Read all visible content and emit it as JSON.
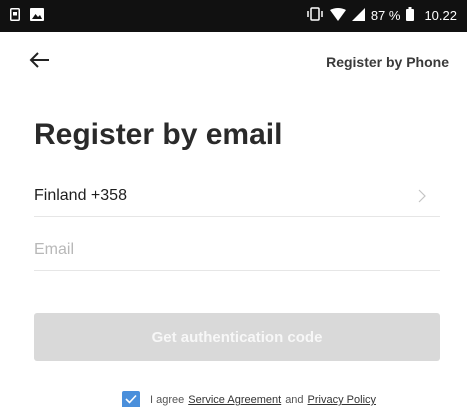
{
  "status_bar": {
    "battery_percent": "87 %",
    "time": "10.22",
    "left_icons": [
      "sim-notification-icon",
      "image-notification-icon"
    ],
    "right_icons": [
      "vibrate-icon",
      "wifi-icon",
      "signal-icon",
      "battery-icon"
    ]
  },
  "header": {
    "back_icon": "arrow-left-icon",
    "register_by_phone": "Register by Phone"
  },
  "title": "Register by email",
  "country": {
    "value": "Finland +358",
    "chevron_icon": "chevron-right-icon"
  },
  "email": {
    "placeholder": "Email",
    "value": ""
  },
  "get_code_button": "Get authentication code",
  "agreement": {
    "checked": true,
    "prefix": "I agree",
    "service_link": "Service Agreement",
    "and": "and",
    "privacy_link": "Privacy Policy"
  },
  "colors": {
    "accent": "#4a8fdb",
    "button_disabled": "#d9d9d9",
    "status_bar": "#111111"
  }
}
